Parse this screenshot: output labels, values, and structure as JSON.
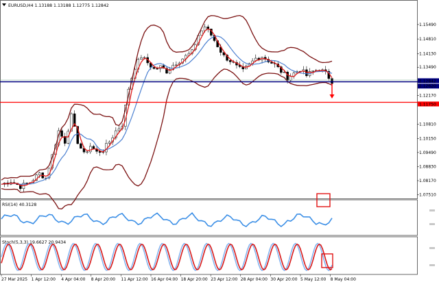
{
  "window": {
    "header": "EURUSD,H4  1.13188 1.13188 1.12775 1.12842",
    "collapse_icon": "triangle-down-icon"
  },
  "colors": {
    "candle": "#000000",
    "bb": "#7a1010",
    "ma_fast": "#e01818",
    "ma_slow": "#4a7fd0",
    "support_line": "#000080",
    "target_line": "#ff0000",
    "current_price_bg": "#000080",
    "rsi_line": "#3a8ee6",
    "stoch_main": "#7fb2f0",
    "stoch_signal": "#d81818",
    "highlight_box": "#e01010"
  },
  "price_axis": {
    "labels": [
      "1.15490",
      "1.14810",
      "1.14130",
      "1.13490",
      "1.12842",
      "1.12620",
      "1.12170",
      "1.11750",
      "1.10810",
      "1.10150",
      "1.09490",
      "1.08830",
      "1.08170",
      "1.07510"
    ],
    "values": [
      1.1549,
      1.1481,
      1.1413,
      1.1349,
      1.12842,
      1.1262,
      1.1217,
      1.1175,
      1.1081,
      1.1015,
      1.0949,
      1.0883,
      1.0817,
      1.0751
    ],
    "current_price": "1.12842",
    "support_price": "1.12620",
    "target_price": "1.11750"
  },
  "rsi": {
    "label": "RSI(14) 40.3128",
    "levels": [
      "70",
      "30"
    ]
  },
  "stoch": {
    "label": "Stoch(5,3,3) 19.6627 20.9434",
    "levels": [
      "80",
      "20"
    ]
  },
  "time_axis": [
    "27 Mar 2025",
    "1 Apr 12:00",
    "4 Apr 04:00",
    "8 Apr 20:00",
    "11 Apr 12:00",
    "16 Apr 04:00",
    "18 Apr 20:00",
    "23 Apr 12:00",
    "28 Apr 04:00",
    "30 Apr 20:00",
    "5 May 12:00",
    "8 May 04:00"
  ],
  "chart_data": {
    "type": "candlestick",
    "symbol": "EURUSD",
    "timeframe": "H4",
    "ohlc_last": {
      "open": 1.13188,
      "high": 1.13188,
      "low": 1.12775,
      "close": 1.12842
    },
    "ylim": [
      1.074,
      1.16
    ],
    "close_path": [
      [
        0,
        1.08
      ],
      [
        3,
        1.0815
      ],
      [
        6,
        1.079
      ],
      [
        9,
        1.081
      ],
      [
        12,
        1.085
      ],
      [
        14,
        1.083
      ],
      [
        16,
        1.0935
      ],
      [
        18,
        1.105
      ],
      [
        20,
        1.1
      ],
      [
        22,
        1.112
      ],
      [
        24,
        1.1
      ],
      [
        26,
        1.094
      ],
      [
        28,
        1.098
      ],
      [
        30,
        1.095
      ],
      [
        32,
        1.096
      ],
      [
        34,
        1.1
      ],
      [
        36,
        1.105
      ],
      [
        38,
        1.108
      ],
      [
        40,
        1.125
      ],
      [
        42,
        1.135
      ],
      [
        44,
        1.14
      ],
      [
        46,
        1.137
      ],
      [
        48,
        1.134
      ],
      [
        50,
        1.135
      ],
      [
        52,
        1.133
      ],
      [
        54,
        1.136
      ],
      [
        56,
        1.138
      ],
      [
        58,
        1.14
      ],
      [
        60,
        1.142
      ],
      [
        62,
        1.15
      ],
      [
        64,
        1.154
      ],
      [
        66,
        1.15
      ],
      [
        68,
        1.145
      ],
      [
        70,
        1.14
      ],
      [
        72,
        1.138
      ],
      [
        74,
        1.135
      ],
      [
        76,
        1.133
      ],
      [
        78,
        1.136
      ],
      [
        80,
        1.139
      ],
      [
        82,
        1.14
      ],
      [
        84,
        1.138
      ],
      [
        86,
        1.136
      ],
      [
        88,
        1.133
      ],
      [
        90,
        1.13
      ],
      [
        92,
        1.132
      ],
      [
        94,
        1.134
      ],
      [
        96,
        1.131
      ],
      [
        98,
        1.133
      ],
      [
        100,
        1.134
      ],
      [
        102,
        1.132
      ],
      [
        104,
        1.1284
      ]
    ],
    "rsi_value": 40.3128,
    "stoch_main": 19.6627,
    "stoch_signal": 20.9434
  }
}
